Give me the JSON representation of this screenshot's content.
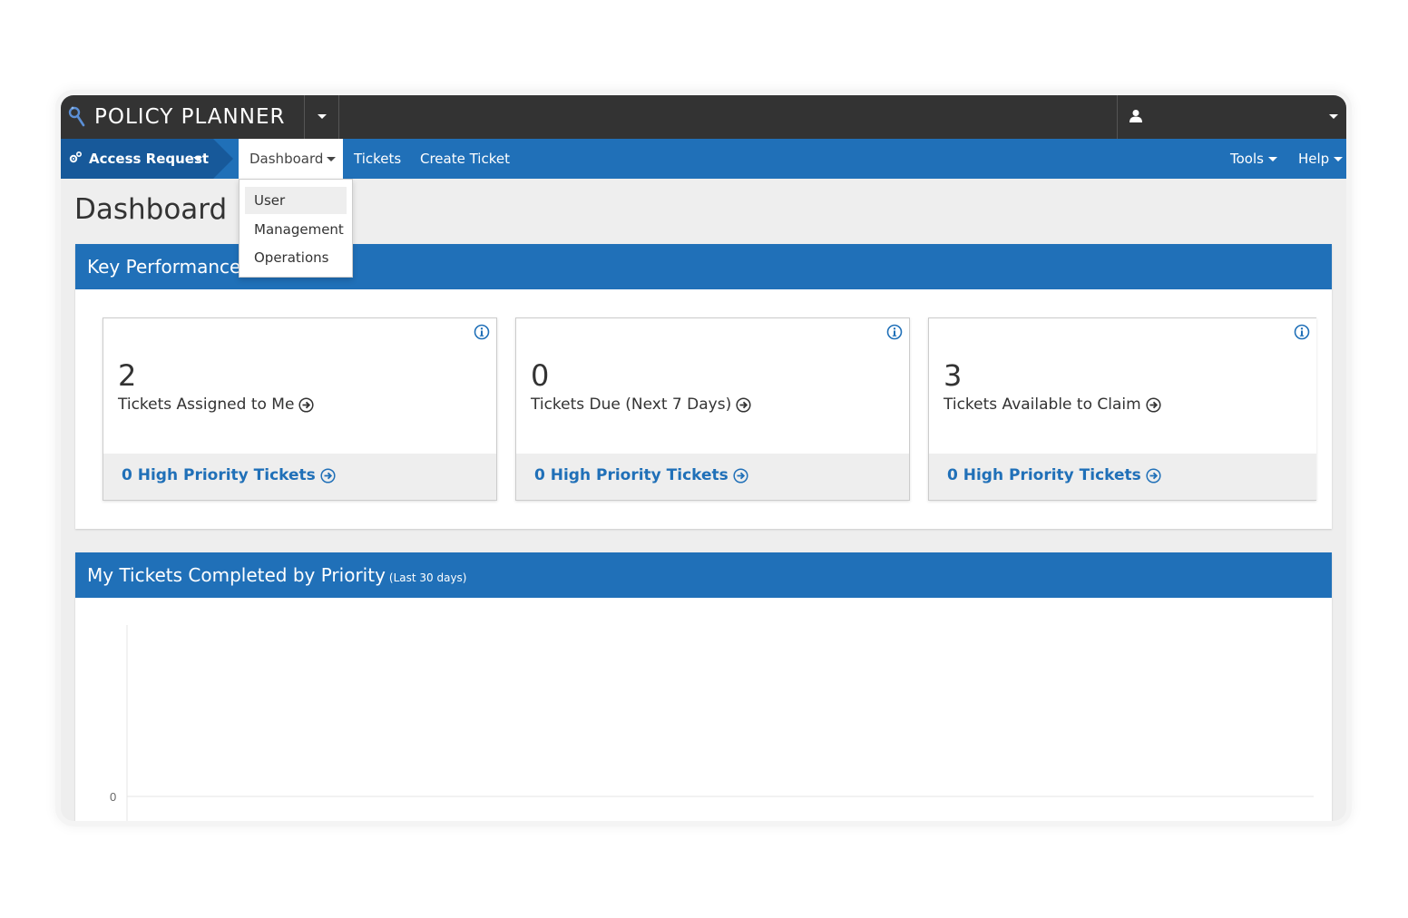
{
  "app": {
    "brand": "POLICY PLANNER"
  },
  "nav": {
    "module": "Access Request",
    "items": [
      {
        "label": "Dashboard"
      },
      {
        "label": "Tickets"
      },
      {
        "label": "Create Ticket"
      }
    ],
    "right": [
      {
        "label": "Tools"
      },
      {
        "label": "Help"
      }
    ]
  },
  "dropdown": {
    "items": [
      {
        "label": "User",
        "active": true
      },
      {
        "label": "Management"
      },
      {
        "label": "Operations"
      }
    ]
  },
  "page": {
    "title": "Dashboard |"
  },
  "kpi_panel": {
    "title": "Key Performance I",
    "cards": [
      {
        "value": "2",
        "label": "Tickets Assigned to Me",
        "link": "0 High Priority Tickets"
      },
      {
        "value": "0",
        "label": "Tickets Due (Next 7 Days)",
        "link": "0 High Priority Tickets"
      },
      {
        "value": "3",
        "label": "Tickets Available to Claim",
        "link": "0 High Priority Tickets"
      }
    ]
  },
  "chart_panel": {
    "title": "My Tickets Completed by Priority",
    "subtitle": "(Last 30 days)"
  },
  "chart_data": {
    "type": "bar",
    "title": "My Tickets Completed by Priority",
    "categories": [],
    "series": [],
    "y_ticks": [
      "0"
    ]
  },
  "colors": {
    "topbar": "#333333",
    "primary": "#2070b8",
    "module": "#17599a",
    "background": "#eeeeee"
  },
  "icons": {
    "brand": "policy-planner-logo-icon",
    "user": "user-icon",
    "module": "gears-icon",
    "info": "info-icon",
    "arrow": "arrow-circle-right-icon"
  }
}
